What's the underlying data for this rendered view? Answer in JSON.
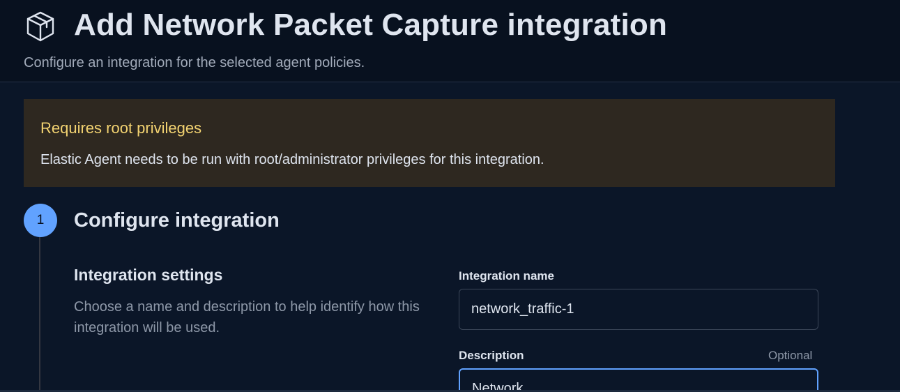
{
  "header": {
    "icon": "package-icon",
    "title": "Add Network Packet Capture integration",
    "subtitle": "Configure an integration for the selected agent policies."
  },
  "callout": {
    "title": "Requires root privileges",
    "text": "Elastic Agent needs to be run with root/administrator privileges for this integration.",
    "color": "#f3d371"
  },
  "step": {
    "number": "1",
    "title": "Configure integration"
  },
  "settings": {
    "title": "Integration settings",
    "description": "Choose a name and description to help identify how this integration will be used.",
    "name_label": "Integration name",
    "name_value": "network_traffic-1",
    "description_label": "Description",
    "description_optional": "Optional",
    "description_value": "Network"
  },
  "colors": {
    "accent": "#61a2ff",
    "background": "#0b1628",
    "warning": "#f3d371"
  }
}
